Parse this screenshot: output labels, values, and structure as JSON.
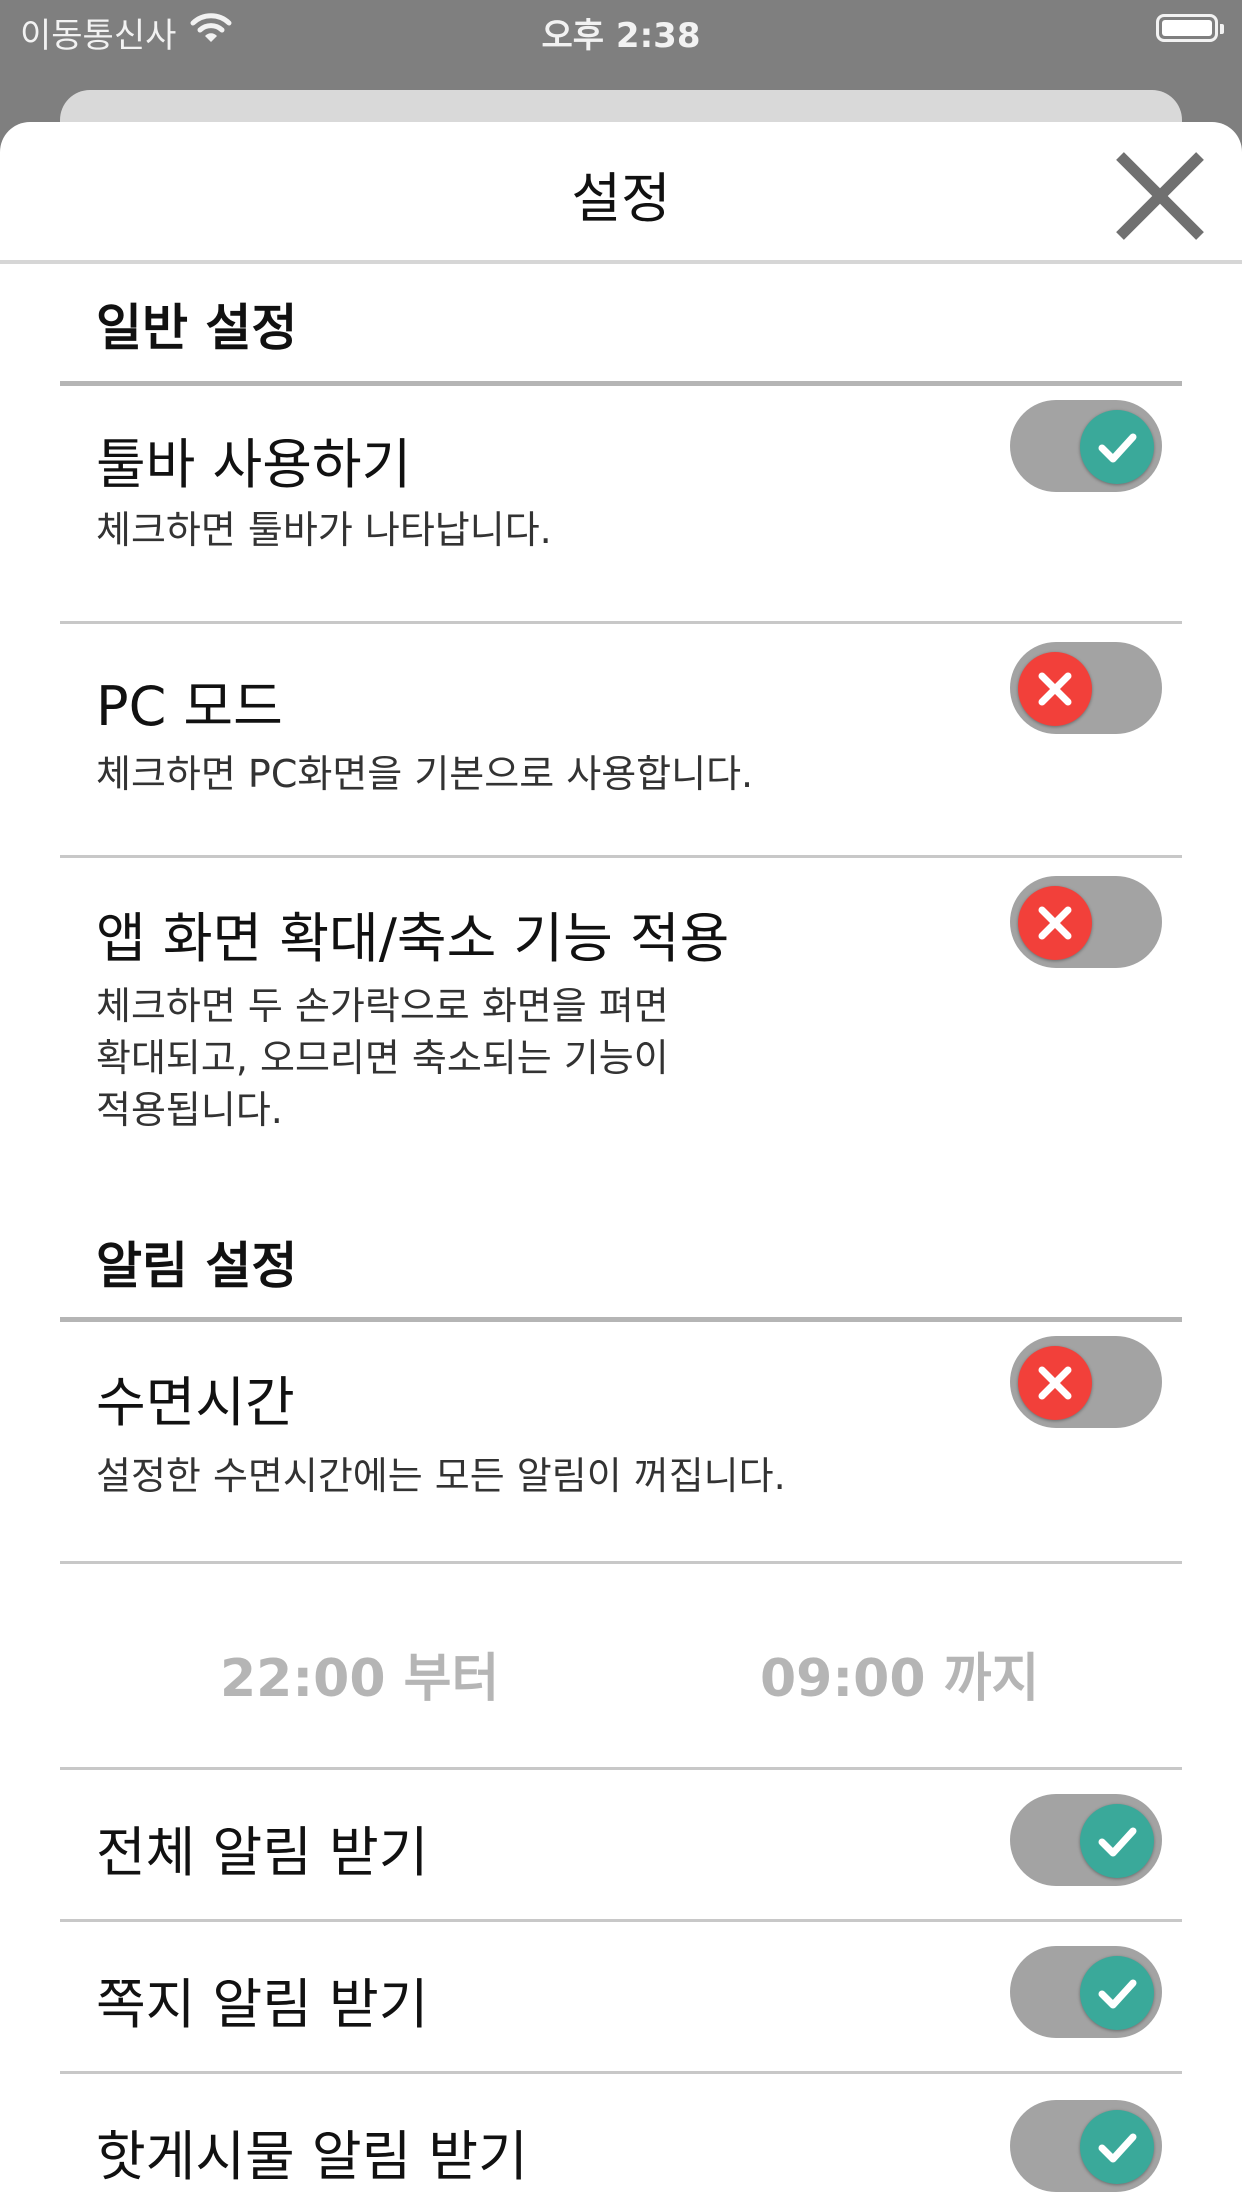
{
  "status_bar": {
    "carrier": "이동통신사",
    "time": "오후 2:38"
  },
  "header": {
    "title": "설정"
  },
  "sections": {
    "general": {
      "title": "일반 설정",
      "toolbar": {
        "title": "툴바 사용하기",
        "desc": "체크하면 툴바가 나타납니다.",
        "state": "on"
      },
      "pc_mode": {
        "title": "PC 모드",
        "desc": "체크하면 PC화면을 기본으로 사용합니다.",
        "state": "off"
      },
      "zoom": {
        "title": "앱 화면 확대/축소 기능 적용",
        "desc": "체크하면 두 손가락으로 화면을 펴면\n확대되고, 오므리면 축소되는 기능이\n적용됩니다.",
        "state": "off"
      }
    },
    "notification": {
      "title": "알림 설정",
      "sleep": {
        "title": "수면시간",
        "desc": "설정한 수면시간에는 모든 알림이 꺼집니다.",
        "state": "off"
      },
      "sleep_from": "22:00 부터",
      "sleep_to": "09:00 까지",
      "all": {
        "title": "전체 알림 받기",
        "state": "on"
      },
      "message": {
        "title": "쪽지 알림 받기",
        "state": "on"
      },
      "hot_post": {
        "title": "핫게시물 알림 받기",
        "state": "on"
      }
    }
  },
  "colors": {
    "toggle_on": "#3aa99a",
    "toggle_off": "#f2403a",
    "toggle_track": "#a3a3a3"
  }
}
